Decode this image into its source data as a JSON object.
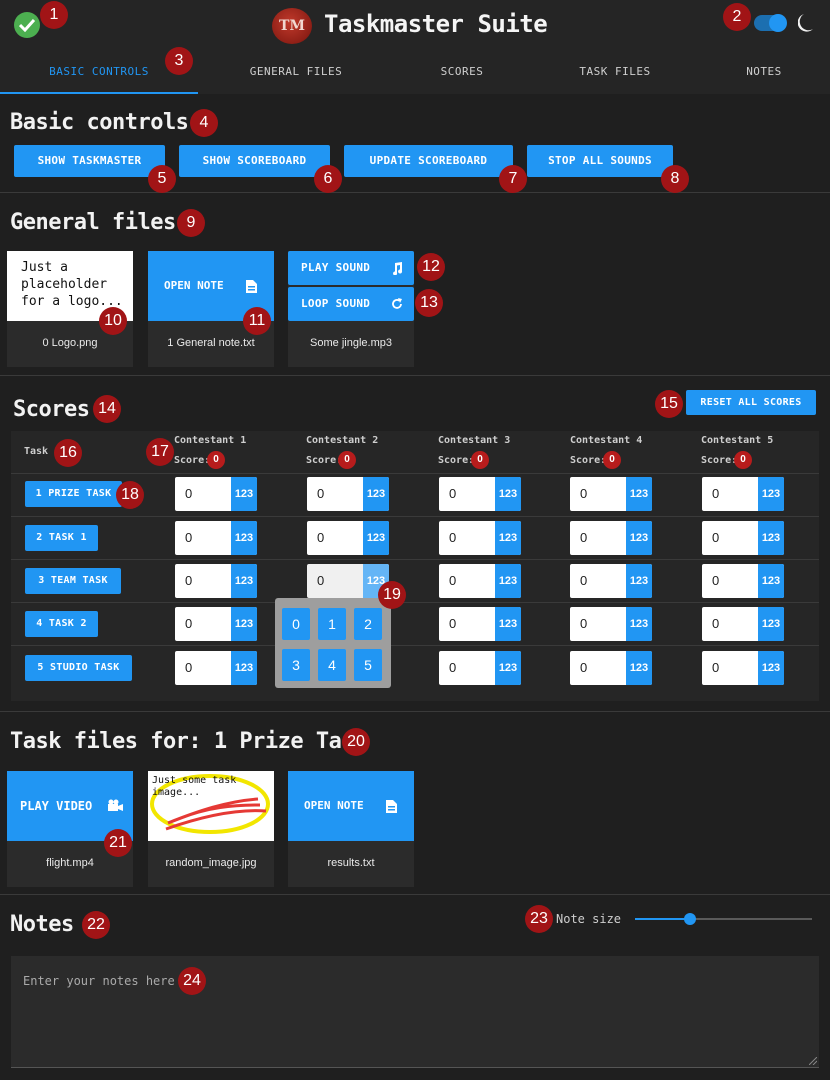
{
  "app": {
    "title": "Taskmaster Suite",
    "logo_text": "TM"
  },
  "header": {
    "status_icon": "check-circle-icon",
    "theme_icon": "moon-icon"
  },
  "tabs": [
    {
      "label": "BASIC CONTROLS",
      "active": true
    },
    {
      "label": "GENERAL FILES",
      "active": false
    },
    {
      "label": "SCORES",
      "active": false
    },
    {
      "label": "TASK FILES",
      "active": false
    },
    {
      "label": "NOTES",
      "active": false
    }
  ],
  "basic_controls": {
    "heading": "Basic controls",
    "buttons": [
      "SHOW TASKMASTER",
      "SHOW SCOREBOARD",
      "UPDATE SCOREBOARD",
      "STOP ALL SOUNDS"
    ]
  },
  "general_files": {
    "heading": "General files",
    "logo_preview_text": "Just a placeholder for a logo...",
    "logo_file": "0 Logo.png",
    "note_button": "OPEN NOTE",
    "note_file": "1 General note.txt",
    "play_sound": "PLAY SOUND",
    "loop_sound": "LOOP SOUND",
    "sound_file": "Some jingle.mp3"
  },
  "scores": {
    "heading": "Scores",
    "reset_button": "RESET ALL SCORES",
    "task_column": "Task",
    "score_label": "Score:",
    "pad_label": "123",
    "contestants": [
      {
        "name": "Contestant 1",
        "score": "0"
      },
      {
        "name": "Contestant 2",
        "score": "0"
      },
      {
        "name": "Contestant 3",
        "score": "0"
      },
      {
        "name": "Contestant 4",
        "score": "0"
      },
      {
        "name": "Contestant 5",
        "score": "0"
      }
    ],
    "tasks": [
      "1 PRIZE TASK",
      "2 TASK 1",
      "3 TEAM TASK",
      "4 TASK 2",
      "5 STUDIO TASK"
    ],
    "cell_value": "0",
    "numpad_keys": [
      "0",
      "1",
      "2",
      "3",
      "4",
      "5"
    ]
  },
  "task_files": {
    "heading": "Task files for: 1 Prize Task",
    "play_video": "PLAY VIDEO",
    "video_file": "flight.mp4",
    "image_preview_text": "Just some task image...",
    "image_file": "random_image.jpg",
    "note_button": "OPEN NOTE",
    "note_file": "results.txt"
  },
  "notes": {
    "heading": "Notes",
    "size_label": "Note size",
    "size_value": 0.31,
    "placeholder": "Enter your notes here"
  },
  "markers": [
    "1",
    "2",
    "3",
    "4",
    "5",
    "6",
    "7",
    "8",
    "9",
    "10",
    "11",
    "12",
    "13",
    "14",
    "15",
    "16",
    "17",
    "18",
    "19",
    "20",
    "21",
    "22",
    "23",
    "24"
  ]
}
